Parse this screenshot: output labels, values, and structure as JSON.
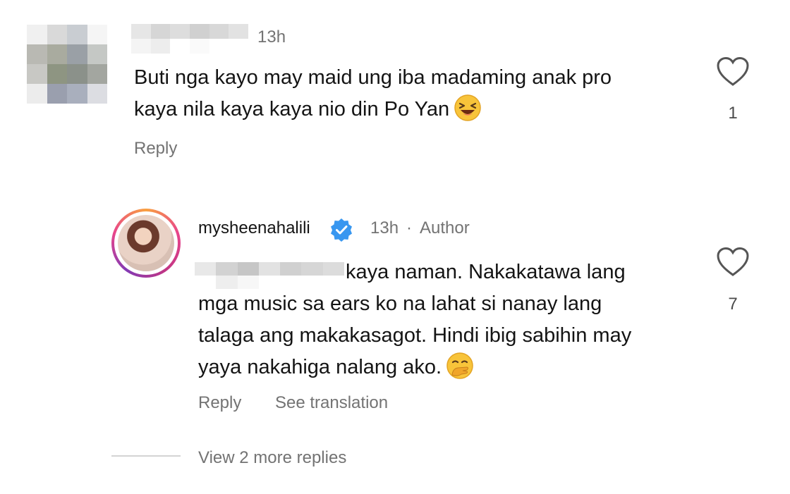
{
  "comment": {
    "time": "13h",
    "text_line1": "Buti nga kayo may maid ung iba madaming anak pro",
    "text_line2": "kaya nila kaya kaya nio din Po Yan",
    "text_emoji": "laughing-face-emoji",
    "like_count": "1",
    "reply_label": "Reply"
  },
  "reply": {
    "username": "mysheenahalili",
    "verified_icon": "verified-badge-icon",
    "time": "13h",
    "separator": "·",
    "author_label": "Author",
    "text_line1": "kaya naman. Nakakatawa lang",
    "text_line2": "mga music sa ears ko na lahat si nanay lang",
    "text_line3": "talaga ang makakasagot. Hindi ibig sabihin may",
    "text_line4": "yaya nakahiga nalang ako.",
    "text_emoji": "face-with-hand-over-mouth-emoji",
    "like_count": "7",
    "reply_label": "Reply",
    "see_translation_label": "See translation"
  },
  "view_more_replies": "View 2 more replies",
  "colors": {
    "muted_text": "#737373",
    "verified_blue": "#3897f0",
    "avatar_ring": [
      "#f9a03f",
      "#e8458b",
      "#833ab4"
    ]
  }
}
